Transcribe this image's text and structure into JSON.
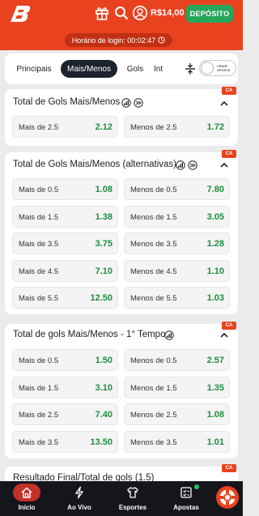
{
  "header": {
    "balance": "R$14,00",
    "deposit_label": "DEPÓSITO",
    "login_time": "Horário de login: 00:02:47",
    "colors": {
      "primary": "#e8421f",
      "deposit": "#26a65b"
    }
  },
  "tabs": [
    {
      "label": "Principais",
      "active": false
    },
    {
      "label": "Mais/Menos",
      "active": true
    },
    {
      "label": "Gols",
      "active": false
    },
    {
      "label": "Int",
      "active": false
    }
  ],
  "toggle_label": "CRIAR APOSTA",
  "ca_badge": "CA",
  "markets": [
    {
      "title": "Total de Gols Mais/Menos",
      "rows": [
        [
          {
            "label": "Mais de 2.5",
            "odd": "2.12"
          },
          {
            "label": "Menos de 2.5",
            "odd": "1.72"
          }
        ]
      ]
    },
    {
      "title": "Total de Gols Mais/Menos (alternativas)",
      "rows": [
        [
          {
            "label": "Mais de 0.5",
            "odd": "1.08"
          },
          {
            "label": "Menos de 0.5",
            "odd": "7.80"
          }
        ],
        [
          {
            "label": "Mais de 1.5",
            "odd": "1.38"
          },
          {
            "label": "Menos de 1.5",
            "odd": "3.05"
          }
        ],
        [
          {
            "label": "Mais de 3.5",
            "odd": "3.75"
          },
          {
            "label": "Menos de 3.5",
            "odd": "1.28"
          }
        ],
        [
          {
            "label": "Mais de 4.5",
            "odd": "7.10"
          },
          {
            "label": "Menos de 4.5",
            "odd": "1.10"
          }
        ],
        [
          {
            "label": "Mais de 5.5",
            "odd": "12.50"
          },
          {
            "label": "Menos de 5.5",
            "odd": "1.03"
          }
        ]
      ]
    },
    {
      "title": "Total de gols Mais/Menos - 1° Tempo",
      "rows": [
        [
          {
            "label": "Mais de 0.5",
            "odd": "1.50"
          },
          {
            "label": "Menos de 0.5",
            "odd": "2.57"
          }
        ],
        [
          {
            "label": "Mais de 1.5",
            "odd": "3.10"
          },
          {
            "label": "Menos de 1.5",
            "odd": "1.35"
          }
        ],
        [
          {
            "label": "Mais de 2.5",
            "odd": "7.40"
          },
          {
            "label": "Menos de 2.5",
            "odd": "1.08"
          }
        ],
        [
          {
            "label": "Mais de 3.5",
            "odd": "13.50"
          },
          {
            "label": "Menos de 3.5",
            "odd": "1.01"
          }
        ]
      ]
    },
    {
      "title": "Resultado Final/Total de gols (1.5)",
      "rows": []
    }
  ],
  "bottom_nav": [
    {
      "label": "Início",
      "icon": "home-icon",
      "active": true
    },
    {
      "label": "Ao Vivo",
      "icon": "lightning-icon",
      "active": false
    },
    {
      "label": "Esportes",
      "icon": "shirt-icon",
      "active": false
    },
    {
      "label": "Apostas",
      "icon": "betslip-icon",
      "active": false
    }
  ]
}
